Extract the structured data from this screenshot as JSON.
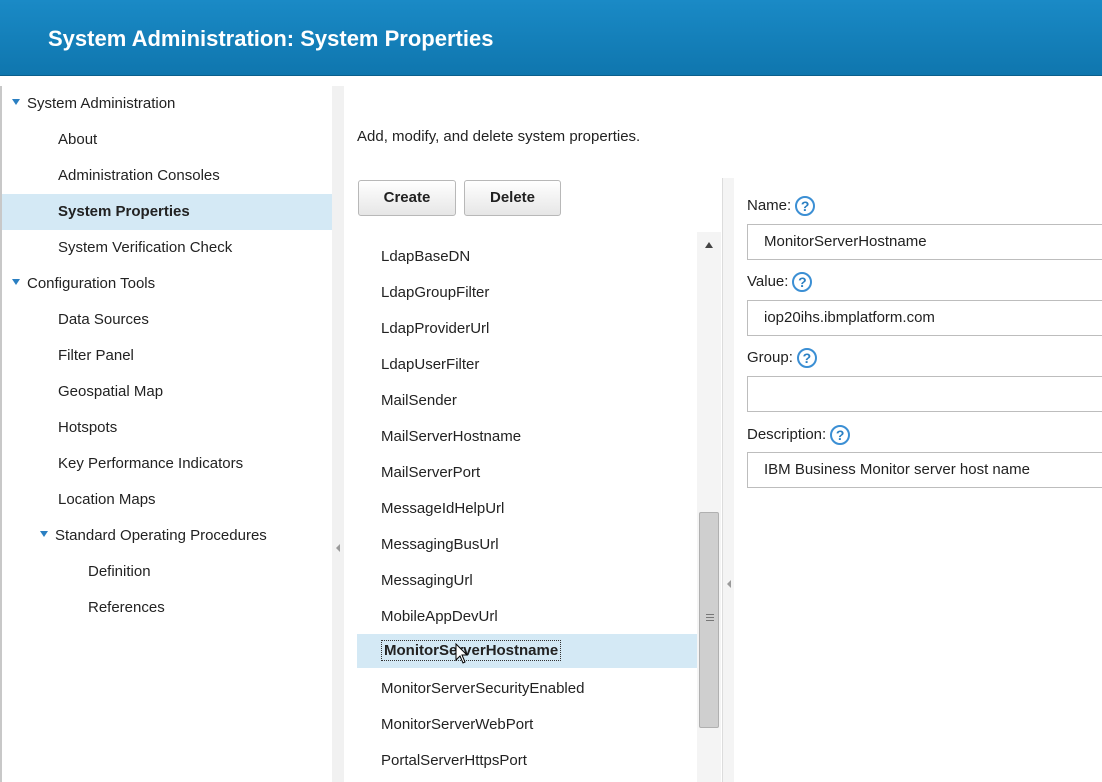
{
  "header": {
    "title": "System Administration: System Properties"
  },
  "sidebar": {
    "items": [
      {
        "label": "System Administration"
      },
      {
        "label": "About"
      },
      {
        "label": "Administration Consoles"
      },
      {
        "label": "System Properties"
      },
      {
        "label": "System Verification Check"
      },
      {
        "label": "Configuration Tools"
      },
      {
        "label": "Data Sources"
      },
      {
        "label": "Filter Panel"
      },
      {
        "label": "Geospatial Map"
      },
      {
        "label": "Hotspots"
      },
      {
        "label": "Key Performance Indicators"
      },
      {
        "label": "Location Maps"
      },
      {
        "label": "Standard Operating Procedures"
      },
      {
        "label": "Definition"
      },
      {
        "label": "References"
      }
    ]
  },
  "main": {
    "intro": "Add, modify, and delete system properties.",
    "create_label": "Create",
    "delete_label": "Delete",
    "properties": [
      "LdapBaseDN",
      "LdapGroupFilter",
      "LdapProviderUrl",
      "LdapUserFilter",
      "MailSender",
      "MailServerHostname",
      "MailServerPort",
      "MessageIdHelpUrl",
      "MessagingBusUrl",
      "MessagingUrl",
      "MobileAppDevUrl",
      "MonitorServerHostname",
      "MonitorServerSecurityEnabled",
      "MonitorServerWebPort",
      "PortalServerHttpsPort"
    ],
    "selected_property": "MonitorServerHostname"
  },
  "form": {
    "name_label": "Name:",
    "name_value": "MonitorServerHostname",
    "value_label": "Value:",
    "value_value": "iop20ihs.ibmplatform.com",
    "group_label": "Group:",
    "group_value": "",
    "description_label": "Description:",
    "description_value": "IBM Business Monitor server host name",
    "help_glyph": "?"
  },
  "colors": {
    "header": "#1484c0",
    "selection": "#d4e9f5",
    "help_icon": "#3b8fd4"
  }
}
